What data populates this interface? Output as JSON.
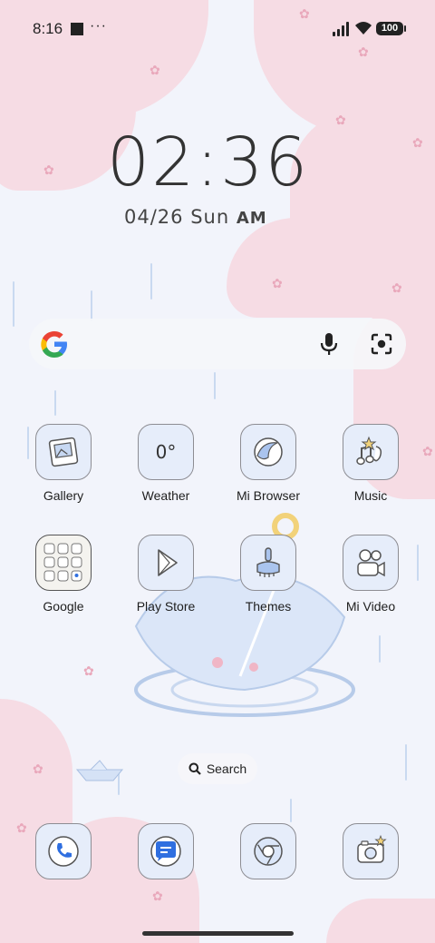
{
  "status_bar": {
    "time": "8:16",
    "more": "···",
    "battery": "100"
  },
  "clock": {
    "time": "02:36",
    "date": "04/26 Sun",
    "period": "AM"
  },
  "search_widget": {
    "logo": "google-g-icon",
    "mic": "microphone-icon",
    "lens": "lens-camera-icon"
  },
  "apps": [
    {
      "label": "Gallery",
      "icon": "gallery-icon"
    },
    {
      "label": "Weather",
      "icon": "weather-icon",
      "temp": "0°"
    },
    {
      "label": "Mi Browser",
      "icon": "browser-icon"
    },
    {
      "label": "Music",
      "icon": "music-icon"
    },
    {
      "label": "Google",
      "icon": "google-folder-icon"
    },
    {
      "label": "Play Store",
      "icon": "play-store-icon"
    },
    {
      "label": "Themes",
      "icon": "themes-brush-icon"
    },
    {
      "label": "Mi Video",
      "icon": "video-camera-icon"
    }
  ],
  "home_search": {
    "label": "Search",
    "icon": "search-icon"
  },
  "dock": [
    {
      "icon": "phone-icon"
    },
    {
      "icon": "messages-icon"
    },
    {
      "icon": "chrome-icon"
    },
    {
      "icon": "camera-icon"
    }
  ],
  "colors": {
    "background": "#f2f4fb",
    "blossom": "#f6dce4",
    "icon_bg": "#e6edfa",
    "accent_blue": "#2f6fe0"
  }
}
